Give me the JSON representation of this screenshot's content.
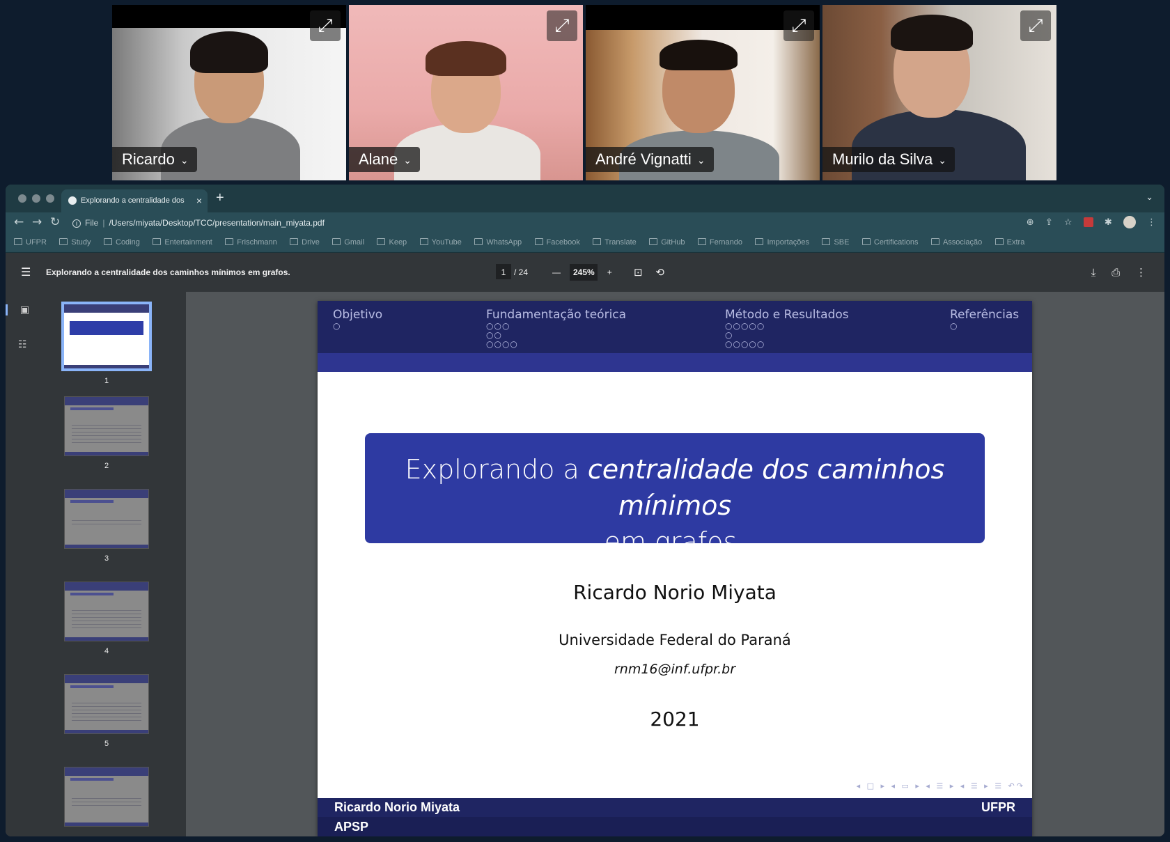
{
  "participants": [
    {
      "name": "Ricardo"
    },
    {
      "name": "Alane"
    },
    {
      "name": "André Vignatti"
    },
    {
      "name": "Murilo da Silva",
      "active_speaker": true
    }
  ],
  "browser": {
    "tab_title": "Explorando a centralidade dos",
    "address_prefix": "File",
    "address": "/Users/miyata/Desktop/TCC/presentation/main_miyata.pdf",
    "bookmarks": [
      "UFPR",
      "Study",
      "Coding",
      "Entertainment",
      "Frischmann",
      "Drive",
      "Gmail",
      "Keep",
      "YouTube",
      "WhatsApp",
      "Facebook",
      "Translate",
      "GitHub",
      "Fernando",
      "Importações",
      "SBE",
      "Certifications",
      "Associação",
      "Extra"
    ]
  },
  "pdf": {
    "doc_title": "Explorando a centralidade dos caminhos mínimos em grafos.",
    "current_page": "1",
    "total_pages": "/ 24",
    "zoom": "245%",
    "thumbnails": [
      "1",
      "2",
      "3",
      "4",
      "5"
    ]
  },
  "slide": {
    "nav_sections": [
      {
        "label": "Objetivo",
        "dots": [
          "○"
        ]
      },
      {
        "label": "Fundamentação teórica",
        "dots": [
          "○○○",
          "○○",
          "○○○○"
        ]
      },
      {
        "label": "Método e Resultados",
        "dots": [
          "○○○○○",
          "○",
          "○○○○○"
        ]
      },
      {
        "label": "Referências",
        "dots": [
          "○"
        ]
      }
    ],
    "title_plain": "Explorando a ",
    "title_italic": "centralidade dos caminhos mínimos",
    "title_end": "em grafos.",
    "author": "Ricardo Norio Miyata",
    "institution": "Universidade Federal do Paraná",
    "email": "rnm16@inf.ufpr.br",
    "year": "2021",
    "footer_author": "Ricardo Norio Miyata",
    "footer_inst": "UFPR",
    "footer_short": "APSP"
  },
  "colors": {
    "slide_nav": "#1f2562",
    "title_box": "#2e3aa2",
    "active_tile_border": "#3f7fd8"
  }
}
